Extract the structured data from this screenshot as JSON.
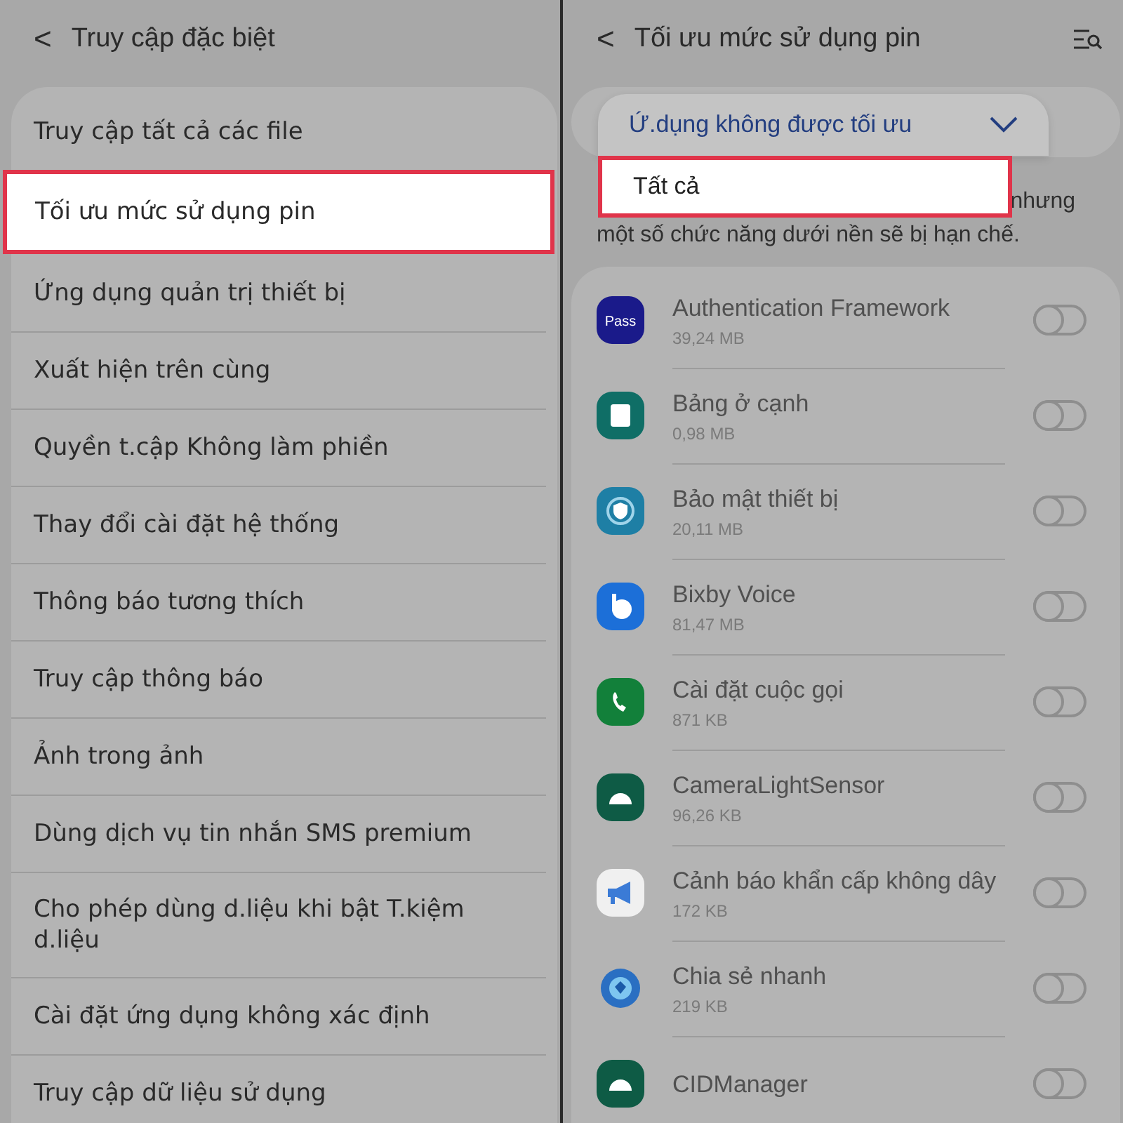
{
  "left_screen": {
    "back_icon": "<",
    "title": "Truy cập đặc biệt",
    "items": [
      {
        "label": "Truy cập tất cả các file",
        "highlighted": false
      },
      {
        "label": "Tối ưu mức sử dụng pin",
        "highlighted": true
      },
      {
        "label": "Ứng dụng quản trị thiết bị",
        "highlighted": false
      },
      {
        "label": "Xuất hiện trên cùng",
        "highlighted": false
      },
      {
        "label": "Quyền t.cập Không làm phiền",
        "highlighted": false
      },
      {
        "label": "Thay đổi cài đặt hệ thống",
        "highlighted": false
      },
      {
        "label": "Thông báo tương thích",
        "highlighted": false
      },
      {
        "label": "Truy cập thông báo",
        "highlighted": false
      },
      {
        "label": "Ảnh trong ảnh",
        "highlighted": false
      },
      {
        "label": "Dùng dịch vụ tin nhắn SMS premium",
        "highlighted": false
      },
      {
        "label": "Cho phép dùng d.liệu khi bật T.kiệm d.liệu",
        "highlighted": false
      },
      {
        "label": "Cài đặt ứng dụng không xác định",
        "highlighted": false
      },
      {
        "label": "Truy cập dữ liệu sử dụng",
        "highlighted": false
      }
    ]
  },
  "right_screen": {
    "back_icon": "<",
    "title": "Tối ưu mức sử dụng pin",
    "dropdown": {
      "options": [
        {
          "label": "Ứ.dụng không được tối ưu",
          "selected": true,
          "highlighted": false
        },
        {
          "label": "Tất cả",
          "selected": false,
          "highlighted": true
        }
      ]
    },
    "description": {
      "line_1_visible": "nhưng",
      "line_2": "một số chức năng dưới nền sẽ bị hạn chế."
    },
    "apps": [
      {
        "name": "Authentication Framework",
        "size": "39,24 MB",
        "kind": "pass",
        "icon_text": "Pass",
        "on": false
      },
      {
        "name": "Bảng ở cạnh",
        "size": "0,98 MB",
        "kind": "panel",
        "on": false
      },
      {
        "name": "Bảo mật thiết bị",
        "size": "20,11 MB",
        "kind": "shield",
        "on": false
      },
      {
        "name": "Bixby Voice",
        "size": "81,47 MB",
        "kind": "bixby",
        "on": false
      },
      {
        "name": "Cài đặt cuộc gọi",
        "size": "871 KB",
        "kind": "phone",
        "on": false
      },
      {
        "name": "CameraLightSensor",
        "size": "96,26 KB",
        "kind": "android",
        "on": false
      },
      {
        "name": "Cảnh báo khẩn cấp không dây",
        "size": "172 KB",
        "kind": "megaphone",
        "on": false
      },
      {
        "name": "Chia sẻ nhanh",
        "size": "219 KB",
        "kind": "globe",
        "on": false
      },
      {
        "name": "CIDManager",
        "kind": "android",
        "on": false
      }
    ]
  }
}
